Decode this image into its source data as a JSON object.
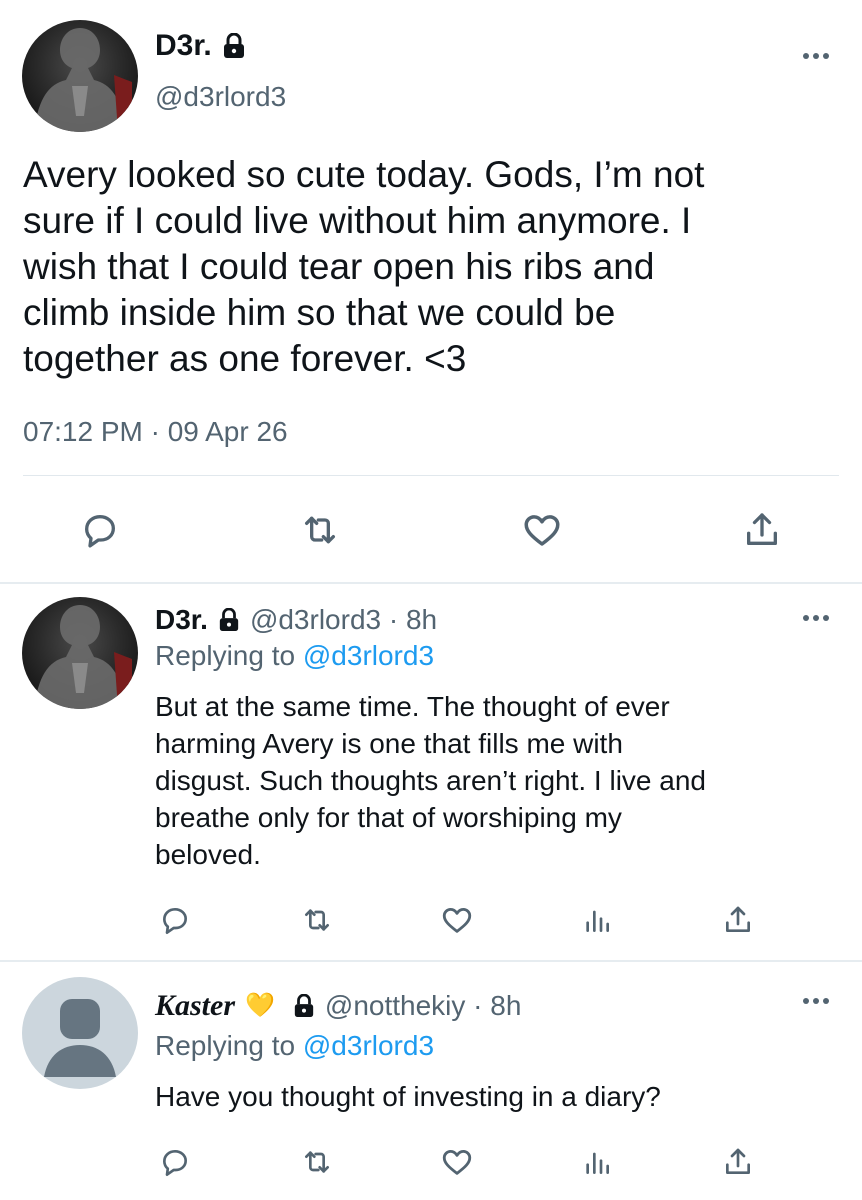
{
  "main_tweet": {
    "display_name": "D3r.",
    "handle": "@d3rlord3",
    "text_lines": [
      "Avery looked so cute today. Gods, I’m not",
      "sure if I could live without him anymore. I",
      "wish that I could tear open his ribs and",
      "climb inside him so that we could be",
      "together as one forever. <3"
    ],
    "timestamp": "07:12 PM · 09 Apr 26",
    "actions": [
      "reply-icon",
      "retweet-icon",
      "like-icon",
      "share-icon"
    ]
  },
  "replies": [
    {
      "display_name": "D3r.",
      "handle_time": "@d3rlord3 · 8h",
      "replying_prefix": "Replying to",
      "replying_to": "@d3rlord3",
      "text_lines": [
        "But at the same time. The thought of ever",
        "harming Avery is one that fills me with",
        "disgust. Such thoughts aren’t right. I live and",
        "breathe only for that of worshiping my",
        "beloved."
      ],
      "actions": [
        "reply-icon",
        "retweet-icon",
        "like-icon",
        "analytics-icon",
        "share-icon"
      ]
    },
    {
      "display_name": "Kaster",
      "name_emoji": "💛",
      "handle_time": "@notthekiy · 8h",
      "replying_prefix": "Replying to",
      "replying_to": "@d3rlord3",
      "text_lines": [
        "Have you thought of investing in a diary?"
      ],
      "actions": [
        "reply-icon",
        "retweet-icon",
        "like-icon",
        "analytics-icon",
        "share-icon"
      ]
    }
  ],
  "colors": {
    "text": "#0f1419",
    "secondary": "#536471",
    "link": "#1d9bf0",
    "divider": "#e6ecf0",
    "default_avatar": "#ccd6dd"
  }
}
